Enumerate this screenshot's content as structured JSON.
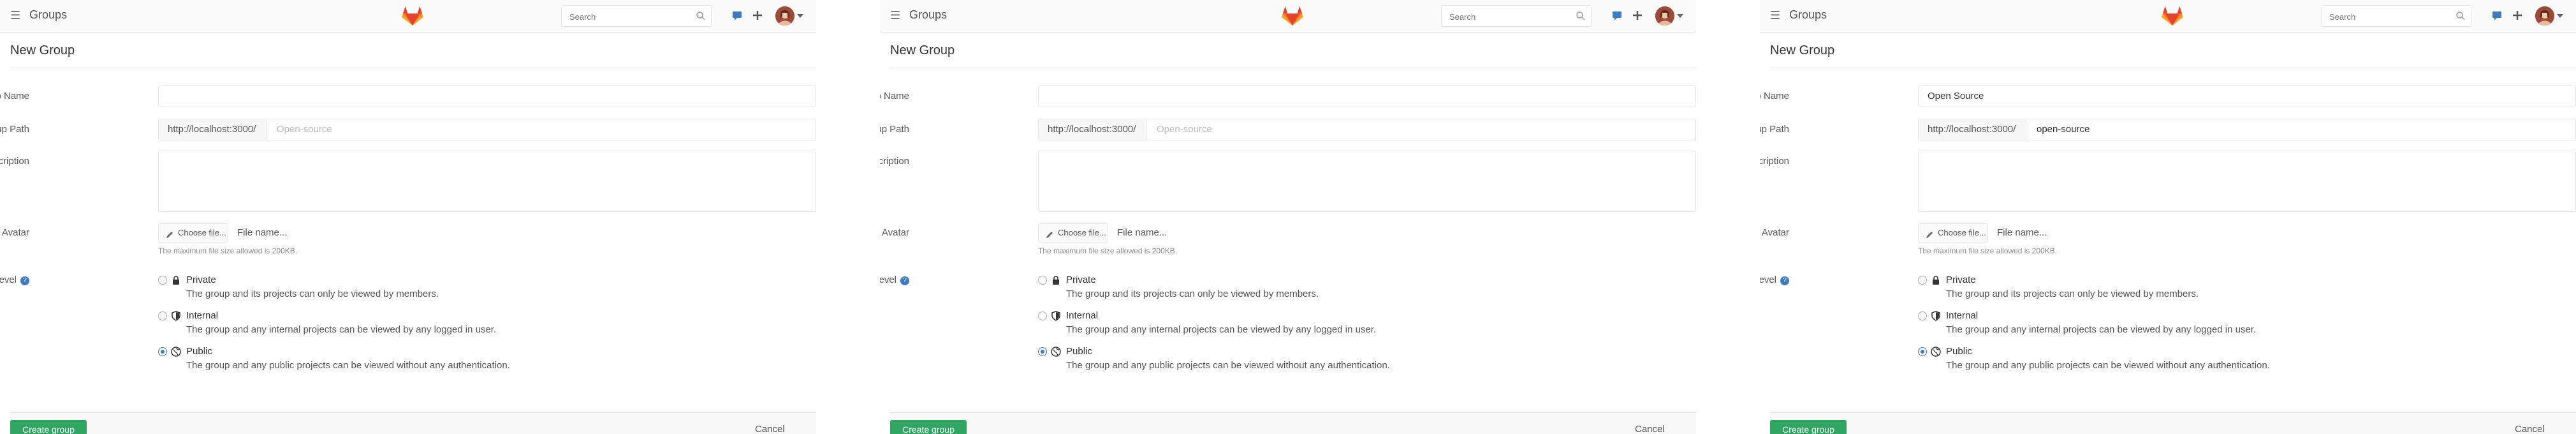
{
  "panels": [
    {
      "header": {
        "title": "Groups",
        "search_placeholder": "Search"
      },
      "page_title": "New Group",
      "form": {
        "group_name_label": "Group Name",
        "group_name_value": "",
        "group_path_label": "Group Path",
        "group_path_prefix": "http://localhost:3000/",
        "group_path_value": "Open-source",
        "group_path_is_placeholder": true,
        "description_label": "Description",
        "avatar_label": "Group Avatar",
        "choose_file_label": "Choose file...",
        "file_name_text": "File name...",
        "file_size_hint": "The maximum file size allowed is 200KB.",
        "visibility_label": "Visibility Level",
        "options": [
          {
            "title": "Private",
            "desc": "The group and its projects can only be viewed by members.",
            "icon": "lock-icon",
            "checked": false
          },
          {
            "title": "Internal",
            "desc": "The group and any internal projects can be viewed by any logged in user.",
            "icon": "shield-icon",
            "checked": false
          },
          {
            "title": "Public",
            "desc": "The group and any public projects can be viewed without any authentication.",
            "icon": "globe-icon",
            "checked": true
          }
        ]
      },
      "footer": {
        "create_label": "Create group",
        "cancel_label": "Cancel"
      }
    },
    {
      "header": {
        "title": "Groups",
        "search_placeholder": "Search"
      },
      "page_title": "New Group",
      "form": {
        "group_name_label": "Group Name",
        "group_name_value": "",
        "group_path_label": "Group Path",
        "group_path_prefix": "http://localhost:3000/",
        "group_path_value": "Open-source",
        "group_path_is_placeholder": true,
        "description_label": "Description",
        "avatar_label": "Group Avatar",
        "choose_file_label": "Choose file...",
        "file_name_text": "File name...",
        "file_size_hint": "The maximum file size allowed is 200KB.",
        "visibility_label": "Visibility Level",
        "options": [
          {
            "title": "Private",
            "desc": "The group and its projects can only be viewed by members.",
            "icon": "lock-icon",
            "checked": false
          },
          {
            "title": "Internal",
            "desc": "The group and any internal projects can be viewed by any logged in user.",
            "icon": "shield-icon",
            "checked": false
          },
          {
            "title": "Public",
            "desc": "The group and any public projects can be viewed without any authentication.",
            "icon": "globe-icon",
            "checked": true
          }
        ]
      },
      "footer": {
        "create_label": "Create group",
        "cancel_label": "Cancel"
      }
    },
    {
      "header": {
        "title": "Groups",
        "search_placeholder": "Search"
      },
      "page_title": "New Group",
      "form": {
        "group_name_label": "Group Name",
        "group_name_value": "Open Source",
        "group_path_label": "Group Path",
        "group_path_prefix": "http://localhost:3000/",
        "group_path_value": "open-source",
        "group_path_is_placeholder": false,
        "description_label": "Description",
        "avatar_label": "Group Avatar",
        "choose_file_label": "Choose file...",
        "file_name_text": "File name...",
        "file_size_hint": "The maximum file size allowed is 200KB.",
        "visibility_label": "Visibility Level",
        "options": [
          {
            "title": "Private",
            "desc": "The group and its projects can only be viewed by members.",
            "icon": "lock-icon",
            "checked": false
          },
          {
            "title": "Internal",
            "desc": "The group and any internal projects can be viewed by any logged in user.",
            "icon": "shield-icon",
            "checked": false
          },
          {
            "title": "Public",
            "desc": "The group and any public projects can be viewed without any authentication.",
            "icon": "globe-icon",
            "checked": true
          }
        ]
      },
      "footer": {
        "create_label": "Create group",
        "cancel_label": "Cancel"
      }
    }
  ],
  "colors": {
    "accent": "#3b7bbf",
    "create_button": "#31a562",
    "logo_orange": "#e24329"
  }
}
